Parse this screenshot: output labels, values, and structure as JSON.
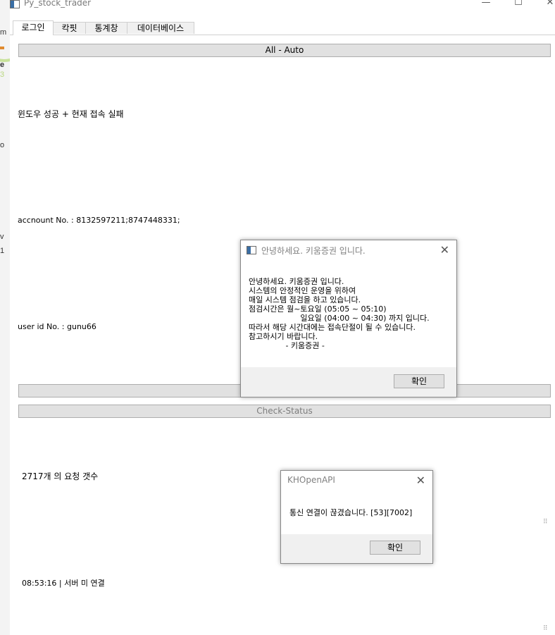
{
  "window": {
    "title": "Py_stock_trader",
    "controls": {
      "minimize": "—",
      "maximize": "☐",
      "close": "✕"
    }
  },
  "tabs": [
    {
      "label": "로그인",
      "active": true
    },
    {
      "label": "칵핏",
      "active": false
    },
    {
      "label": "통계창",
      "active": false
    },
    {
      "label": "데이터베이스",
      "active": false
    }
  ],
  "login_tab": {
    "auto_button": "All - Auto",
    "login_status": "윈도우 성공 + 현재 접속 실패",
    "account_no": "accnount No. : 8132597211;8747448331;",
    "user_id": "user id No. : gunu66",
    "blank_button": "",
    "check_status_button": "Check-Status",
    "request_count": "2717개 의 요청 갯수",
    "server_status": "08:53:16 | 서버 미 연결"
  },
  "kiwoom_dialog": {
    "title": "안녕하세요. 키움증권 입니다.",
    "message": "안녕하세요. 키움증권 입니다.\n시스템의 안정적인 운영을 위하여\n매일 시스템 점검을 하고 있습니다.\n점검시간은 월~토요일 (05:05 ~ 05:10)\n                     일요일 (04:00 ~ 04:30) 까지 입니다.\n따라서 해당 시간대에는 접속단절이 될 수 있습니다.\n참고하시기 바랍니다.\n               - 키움증권 -",
    "ok_label": "확인",
    "close_glyph": "✕"
  },
  "khopenapi_dialog": {
    "title": "KHOpenAPI",
    "message": "통신 연결이 끊겼습니다. [53][7002]",
    "ok_label": "확인",
    "close_glyph": "✕"
  },
  "desktop_edge": {
    "glyphs": [
      "m",
      "e",
      "3",
      "o",
      "v",
      "1"
    ]
  },
  "colors": {
    "accent_ring": "#c8e29a",
    "button_bg": "#e1e1e1",
    "footer_bg": "#f0f0f0"
  }
}
